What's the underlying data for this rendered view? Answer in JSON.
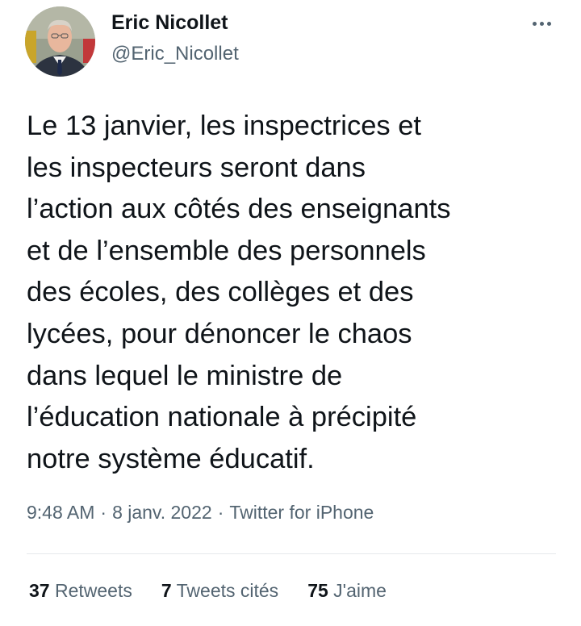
{
  "author": {
    "display_name": "Eric Nicollet",
    "handle": "@Eric_Nicollet",
    "avatar_icon": "profile-photo"
  },
  "more_icon": "more-horizontal-icon",
  "tweet": {
    "text": "Le 13 janvier, les inspectrices et\nles inspecteurs seront dans\nl’action aux côtés des enseignants\net de l’ensemble des personnels\ndes écoles, des collèges et des\nlycées, pour dénoncer le chaos\ndans lequel le ministre de\nl’éducation nationale à précipité\nnotre système éducatif."
  },
  "meta": {
    "time": "9:48 AM",
    "separator": "·",
    "date": "8 janv. 2022",
    "source": "Twitter for iPhone"
  },
  "stats": {
    "retweets": {
      "count": "37",
      "label": "Retweets"
    },
    "quotes": {
      "count": "7",
      "label": "Tweets cités"
    },
    "likes": {
      "count": "75",
      "label": "J'aime"
    }
  },
  "colors": {
    "text_primary": "#0f1419",
    "text_secondary": "#536471",
    "divider": "#e6e9ec"
  }
}
